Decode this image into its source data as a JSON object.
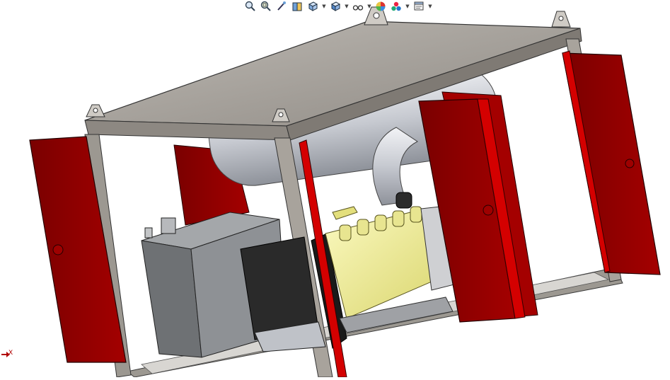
{
  "viewport": {
    "name": "solidworks-3d-viewport",
    "background": "#ffffff"
  },
  "heads_up_toolbar": {
    "items": [
      {
        "name": "zoom-to-fit-icon"
      },
      {
        "name": "zoom-to-area-icon"
      },
      {
        "name": "previous-view-icon"
      },
      {
        "name": "section-view-icon"
      },
      {
        "name": "view-orientation-icon",
        "dropdown": true
      },
      {
        "name": "display-style-icon",
        "dropdown": true
      },
      {
        "name": "hide-show-items-icon",
        "dropdown": true
      },
      {
        "name": "edit-appearance-icon"
      },
      {
        "name": "apply-scene-icon",
        "dropdown": true
      },
      {
        "name": "view-settings-icon",
        "dropdown": true
      }
    ]
  },
  "triad": {
    "axis_label": "X",
    "color": "#b00000"
  },
  "colors": {
    "frame": "#a8a39c",
    "frame_dark": "#6f6b66",
    "door_red": "#8b0000",
    "door_edge": "#d40000",
    "engine_yellow": "#f2f095",
    "tank_grey": "#7c7f82",
    "battery_black": "#262626",
    "exhaust": "#cfd2d8"
  }
}
